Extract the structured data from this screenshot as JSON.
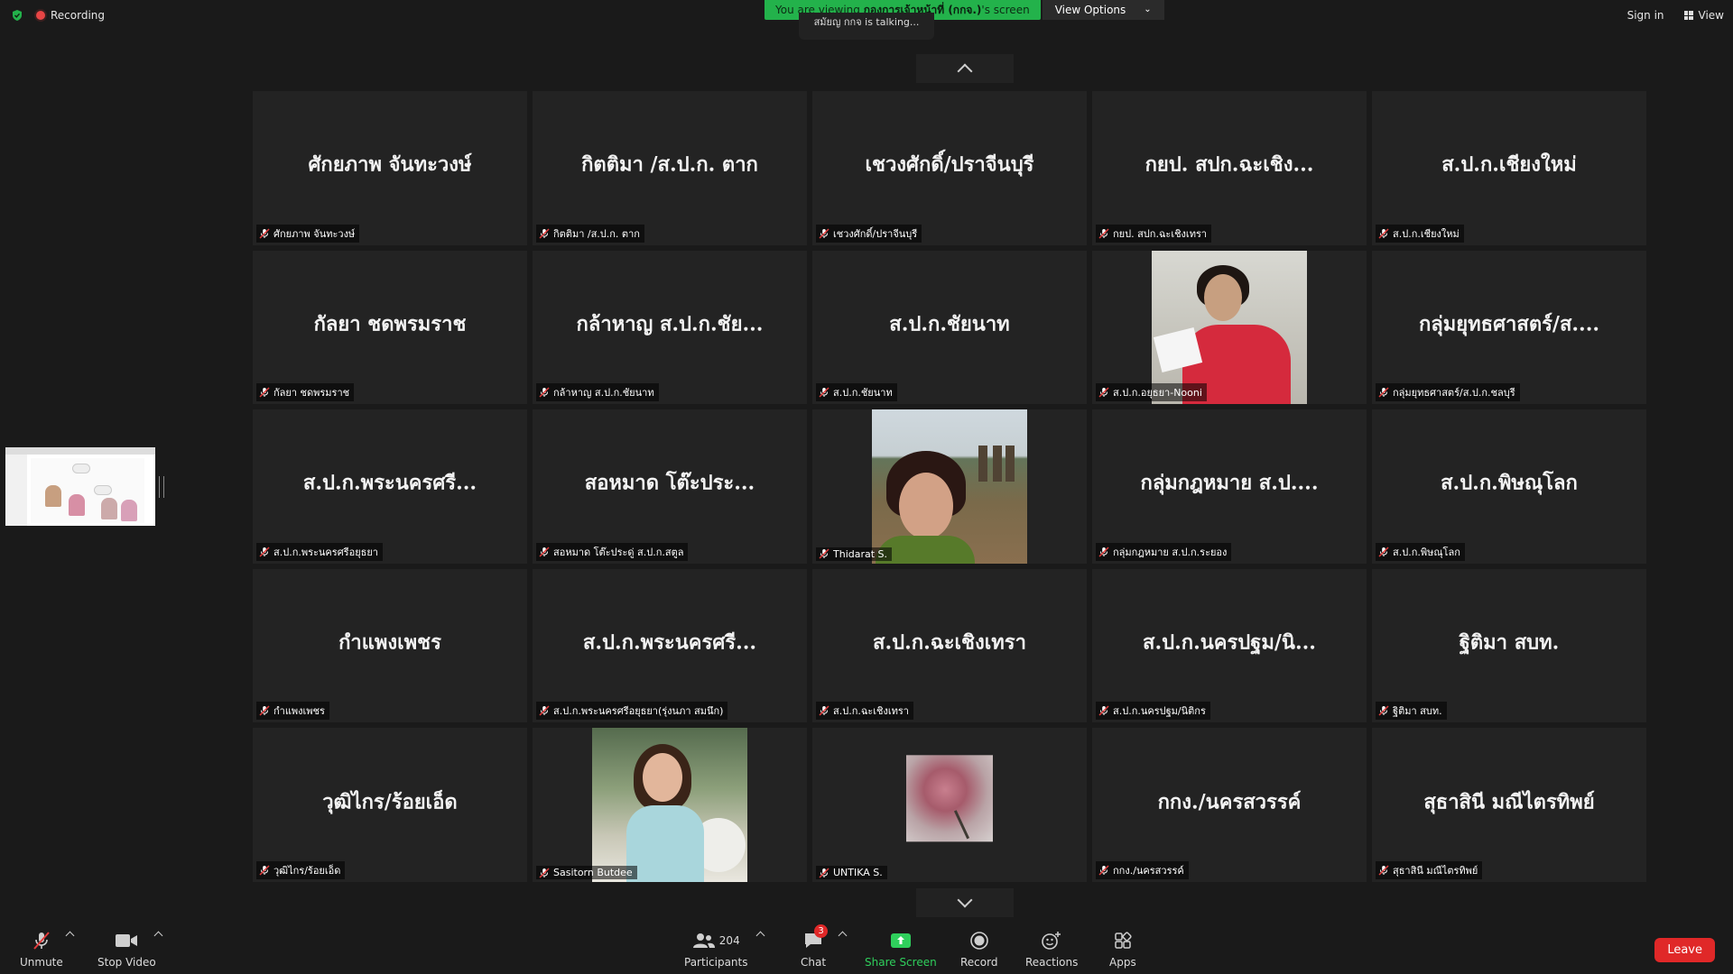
{
  "top": {
    "recording_label": "Recording",
    "viewing_prefix": "You are viewing ",
    "viewing_owner": "กองการเจ้าหน้าที่ (กกจ.)",
    "viewing_suffix": "'s screen",
    "view_options_label": "View Options",
    "talking_text": "สมัยญ กกจ is talking...",
    "sign_in_label": "Sign in",
    "view_label": "View"
  },
  "tiles": [
    {
      "name": "ศักยภาพ จันทะวงษ์",
      "label": "ศักยภาพ จันทะวงษ์",
      "media": "text"
    },
    {
      "name": "กิตติมา /ส.ป.ก. ตาก",
      "label": "กิตติมา /ส.ป.ก. ตาก",
      "media": "text"
    },
    {
      "name": "เชวงศักดิ์/ปราจีนบุรี",
      "label": "เชวงศักดิ์/ปราจีนบุรี",
      "media": "text"
    },
    {
      "name": "กยป. สปก.ฉะเชิง...",
      "label": "กยป. สปก.ฉะเชิงเทรา",
      "media": "text"
    },
    {
      "name": "ส.ป.ก.เชียงใหม่",
      "label": "ส.ป.ก.เชียงใหม่",
      "media": "text"
    },
    {
      "name": "กัลยา ชดพรมราช",
      "label": "กัลยา ชดพรมราช",
      "media": "text"
    },
    {
      "name": "กล้าหาญ ส.ป.ก.ชัย...",
      "label": "กล้าหาญ ส.ป.ก.ชัยนาท",
      "media": "text"
    },
    {
      "name": "ส.ป.ก.ชัยนาท",
      "label": "ส.ป.ก.ชัยนาท",
      "media": "text"
    },
    {
      "name": "",
      "label": "ส.ป.ก.อยุธยา-Nooni",
      "media": "photo-woman-red"
    },
    {
      "name": "กลุ่มยุทธศาสตร์/ส....",
      "label": "กลุ่มยุทธศาสตร์/ส.ป.ก.ชลบุรี",
      "media": "text"
    },
    {
      "name": "ส.ป.ก.พระนครศรี...",
      "label": "ส.ป.ก.พระนครศรีอยุธยา",
      "media": "text"
    },
    {
      "name": "สอหมาด โต๊ะประ...",
      "label": "สอหมาด โต๊ะประดู่ ส.ป.ก.สตูล",
      "media": "text"
    },
    {
      "name": "",
      "label": "Thidarat S.",
      "media": "photo-field"
    },
    {
      "name": "กลุ่มกฎหมาย ส.ป....",
      "label": "กลุ่มกฎหมาย ส.ป.ก.ระยอง",
      "media": "text"
    },
    {
      "name": "ส.ป.ก.พิษณุโลก",
      "label": "ส.ป.ก.พิษณุโลก",
      "media": "text"
    },
    {
      "name": "กำแพงเพชร",
      "label": "กำแพงเพชร",
      "media": "text"
    },
    {
      "name": "ส.ป.ก.พระนครศรี...",
      "label": "ส.ป.ก.พระนครศรีอยุธยา(รุ่งนภา สมนึก)",
      "media": "text"
    },
    {
      "name": "ส.ป.ก.ฉะเชิงเทรา",
      "label": "ส.ป.ก.ฉะเชิงเทรา",
      "media": "text"
    },
    {
      "name": "ส.ป.ก.นครปฐม/นิ...",
      "label": "ส.ป.ก.นครปฐม/นิติกร",
      "media": "text"
    },
    {
      "name": "ฐิติมา สบท.",
      "label": "ฐิติมา สบท.",
      "media": "text"
    },
    {
      "name": "วุฒิไกร/ร้อยเอ็ด",
      "label": "วุฒิไกร/ร้อยเอ็ด",
      "media": "text"
    },
    {
      "name": "",
      "label": "Sasitorn Butdee",
      "media": "photo-party"
    },
    {
      "name": "",
      "label": "UNTIKA S.",
      "media": "rose"
    },
    {
      "name": "กกง./นครสวรรค์",
      "label": "กกง./นครสวรรค์",
      "media": "text"
    },
    {
      "name": "สุธาสินี มณีไตรทิพย์",
      "label": "สุธาสินี มณีไตรทิพย์",
      "media": "text"
    }
  ],
  "toolbar": {
    "unmute": "Unmute",
    "stop_video": "Stop Video",
    "participants": "Participants",
    "participants_count": "204",
    "chat": "Chat",
    "chat_badge": "3",
    "share_screen": "Share Screen",
    "record": "Record",
    "reactions": "Reactions",
    "apps": "Apps",
    "leave": "Leave"
  },
  "icons": {
    "security": "shield-check-icon",
    "recording": "recording-dot-icon",
    "mic": "mic-muted-icon",
    "video": "video-camera-icon",
    "participants": "people-icon",
    "chat": "chat-bubble-icon",
    "share": "share-screen-icon",
    "record": "record-icon",
    "reactions": "emoji-plus-icon",
    "apps": "apps-icon"
  },
  "colors": {
    "banner_green": "#23b24b",
    "leave_red": "#e02828",
    "share_green": "#2fcf5c"
  }
}
